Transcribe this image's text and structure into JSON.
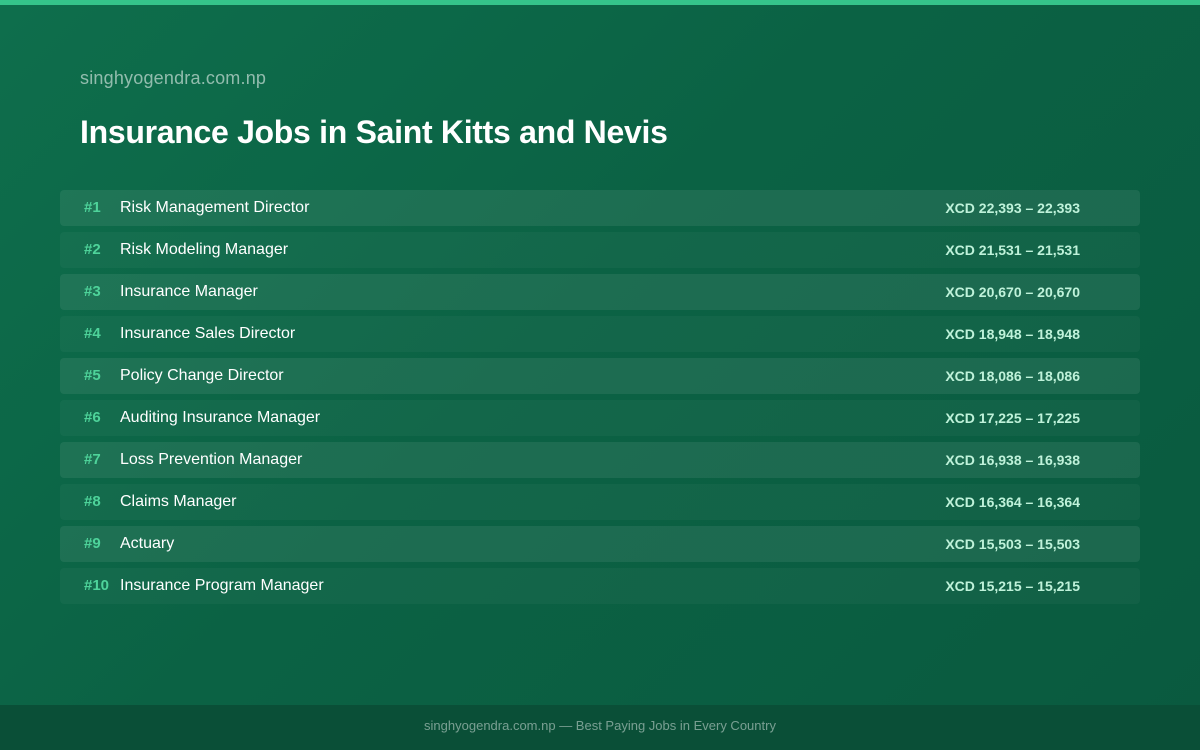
{
  "header": {
    "site_name": "singhyogendra.com.np",
    "title": "Insurance Jobs in Saint Kitts and Nevis"
  },
  "jobs": [
    {
      "rank": "#1",
      "title": "Risk Management Director",
      "salary": "XCD 22,393 – 22,393"
    },
    {
      "rank": "#2",
      "title": "Risk Modeling Manager",
      "salary": "XCD 21,531 – 21,531"
    },
    {
      "rank": "#3",
      "title": "Insurance Manager",
      "salary": "XCD 20,670 – 20,670"
    },
    {
      "rank": "#4",
      "title": "Insurance Sales Director",
      "salary": "XCD 18,948 – 18,948"
    },
    {
      "rank": "#5",
      "title": "Policy Change Director",
      "salary": "XCD 18,086 – 18,086"
    },
    {
      "rank": "#6",
      "title": "Auditing Insurance Manager",
      "salary": "XCD 17,225 – 17,225"
    },
    {
      "rank": "#7",
      "title": "Loss Prevention Manager",
      "salary": "XCD 16,938 – 16,938"
    },
    {
      "rank": "#8",
      "title": "Claims Manager",
      "salary": "XCD 16,364 – 16,364"
    },
    {
      "rank": "#9",
      "title": "Actuary",
      "salary": "XCD 15,503 – 15,503"
    },
    {
      "rank": "#10",
      "title": "Insurance Program Manager",
      "salary": "XCD 15,215 – 15,215"
    }
  ],
  "footer": {
    "text": "singhyogendra.com.np — Best Paying Jobs in Every Country"
  },
  "colors": {
    "background": "#0b6244",
    "accent": "#35c48a",
    "rank": "#4ed39a",
    "salary": "#bff2da",
    "footer_bg": "#0a4f37"
  }
}
